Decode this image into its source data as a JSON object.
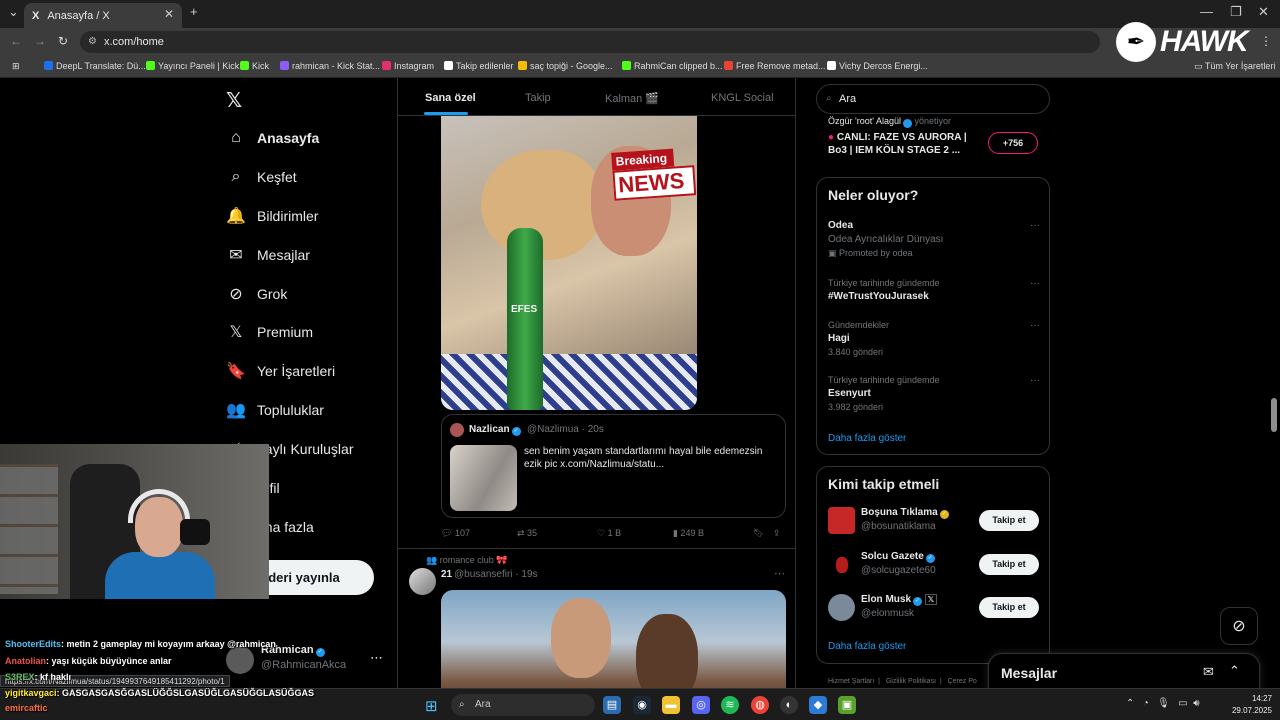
{
  "browser": {
    "tab_title": "Anasayfa / X",
    "tab_favicon": "X",
    "tab_close": "✕",
    "new_tab": "+",
    "url": "x.com/home",
    "bookmarks": [
      {
        "label": "DeepL Translate: Dü...",
        "color": "#1f6feb"
      },
      {
        "label": "Yayıncı Paneli | Kick",
        "color": "#53fc18"
      },
      {
        "label": "Kick",
        "color": "#53fc18"
      },
      {
        "label": "rahmican - Kick Stat...",
        "color": "#8b5cf6"
      },
      {
        "label": "Instagram",
        "color": "#e1306c"
      },
      {
        "label": "Takip edilenler",
        "color": "#ffffff"
      },
      {
        "label": "saç topiği - Google...",
        "color": "#fbbc05"
      },
      {
        "label": "RahmiCan clipped b...",
        "color": "#53fc18"
      },
      {
        "label": "Free Remove metad...",
        "color": "#ea4335"
      },
      {
        "label": "Vichy Dercos Energi...",
        "color": "#ffffff"
      }
    ],
    "all_bookmarks": "Tüm Yer İşaretleri"
  },
  "overlay_logo": "HAWK",
  "nav": {
    "items": [
      {
        "label": "Anasayfa",
        "icon": "⌂"
      },
      {
        "label": "Keşfet",
        "icon": "⌕"
      },
      {
        "label": "Bildirimler",
        "icon": "🔔"
      },
      {
        "label": "Mesajlar",
        "icon": "✉"
      },
      {
        "label": "Grok",
        "icon": "⊘"
      },
      {
        "label": "Premium",
        "icon": "𝕏"
      },
      {
        "label": "Yer İşaretleri",
        "icon": "🔖"
      },
      {
        "label": "Topluluklar",
        "icon": "👥"
      },
      {
        "label": "naylı Kuruluşlar",
        "icon": "⚡"
      },
      {
        "label": "rofil",
        "icon": "👤"
      },
      {
        "label": "aha fazla",
        "icon": "⋯"
      }
    ],
    "post_button": "nderi yayınla",
    "profile": {
      "name": "Rahmican",
      "handle": "@RahmicanAkca",
      "more": "⋯"
    }
  },
  "timeline": {
    "tabs": [
      "Sana özel",
      "Takip",
      "Kalman 🎬",
      "KNGL Social"
    ],
    "breaking": "Breaking",
    "news": "NEWS",
    "bottle_label": "EFES",
    "quote": {
      "name": "Nazlican",
      "handle": "@Nazlimua · 20s",
      "text": "sen benim yaşam standartlarımı hayal bile edemezsin ezik pic  x.com/Nazlimua/statu..."
    },
    "actions": {
      "replies": "107",
      "reposts": "35",
      "likes": "1 B",
      "views": "249 B"
    },
    "post2": {
      "context": "romance club 🎀",
      "name": "21",
      "handle": "@busansefiri · 19s",
      "more": "⋯"
    }
  },
  "right": {
    "search_placeholder": "Ara",
    "live": {
      "host": "Özgür 'root' Alagül",
      "host_suffix": "yönetiyor",
      "title": "CANLI: FAZE VS AURORA | Bo3 | IEM KÖLN STAGE 2 ...",
      "count": "+756"
    },
    "trends_title": "Neler oluyor?",
    "trends": [
      {
        "meta": "",
        "name": "Odea",
        "sub": "Odea Ayrıcalıklar Dünyası",
        "sub2": "Promoted by odea"
      },
      {
        "meta": "Türkiye tarihinde gündemde",
        "name": "#WeTrustYouJurasek",
        "sub": "",
        "sub2": ""
      },
      {
        "meta": "Gündemdekiler",
        "name": "Hagi",
        "sub": "3.840 gönderi",
        "sub2": ""
      },
      {
        "meta": "Türkiye tarihinde gündemde",
        "name": "Esenyurt",
        "sub": "3.982 gönderi",
        "sub2": ""
      }
    ],
    "trend_more": "···",
    "show_more": "Daha fazla göster",
    "who_title": "Kimi takip etmeli",
    "who": [
      {
        "name": "Boşuna Tıklama",
        "handle": "@bosunatiklama",
        "color": "#c62828",
        "badge": "gold"
      },
      {
        "name": "Solcu Gazete",
        "handle": "@solcugazete60",
        "color": "#b71c1c",
        "badge": "blue"
      },
      {
        "name": "Elon Musk",
        "handle": "@elonmusk",
        "color": "#7a8a9a",
        "badge": "blue"
      }
    ],
    "follow_label": "Takip et",
    "who_show_more": "Daha fazla göster",
    "footer": [
      "Hizmet Şartları",
      "Gizlilik Politikası",
      "Çerez Po"
    ],
    "messages_title": "Mesajlar"
  },
  "chat": [
    {
      "user": "ShooterEdits",
      "color": "#4fc3f7",
      "text": ": metin 2 gameplay mi koyayım arkaay @rahmican"
    },
    {
      "user": "Anatolian",
      "color": "#ef5350",
      "text": ": yaşı küçük büyüyünce anlar"
    },
    {
      "user": "S3REX",
      "color": "#66bb6a",
      "text": ": kf haklı"
    },
    {
      "user": "yigitkavgaci",
      "color": "#ffeb3b",
      "text": ": GASGASGASĞGASLÜĞĞSLGASÜĞLGASÜĞGLASÜĞGAS"
    },
    {
      "user": "emircaftic",
      "color": "#ff7043",
      "text": ""
    }
  ],
  "status_url": "https://x.com/Nazlimua/status/1949937649185411292/photo/1",
  "taskbar": {
    "search": "Ara",
    "time": "14:27",
    "date": "29.07.2025"
  }
}
